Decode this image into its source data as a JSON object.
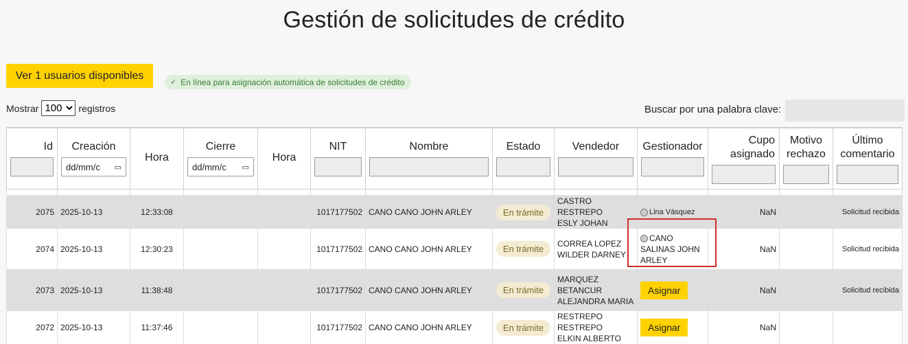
{
  "page": {
    "title": "Gestión de solicitudes de crédito"
  },
  "toolbar": {
    "users_button": "Ver 1 usuarios disponibles",
    "status_text": "En línea para asignación automática de solicitudes de crédito",
    "show_prefix": "Mostrar",
    "show_value": "100",
    "show_suffix": "registros",
    "search_label": "Buscar por una palabra clave:",
    "search_value": ""
  },
  "table": {
    "headers": {
      "id": "Id",
      "creacion": "Creación",
      "hora1": "Hora",
      "cierre": "Cierre",
      "hora2": "Hora",
      "nit": "NIT",
      "nombre": "Nombre",
      "estado": "Estado",
      "vendedor": "Vendedor",
      "gestionador": "Gestionador",
      "cupo_line1": "Cupo",
      "cupo_line2": "asignado",
      "motivo_line1": "Motivo",
      "motivo_line2": "rechazo",
      "ultimo_line1": "Último",
      "ultimo_line2": "comentario"
    },
    "date_placeholder": "dd/mm/c",
    "assign_label": "Asignar",
    "rows": [
      {
        "id": "2075",
        "creacion": "2025-10-13",
        "hora": "12:33:08",
        "cierre": "",
        "hora2": "",
        "nit": "1017177502",
        "nombre": "CANO CANO JOHN ARLEY",
        "estado": "En trámite",
        "vendedor_l1": "CASTRO RESTREPO",
        "vendedor_l2": "ESLY JOHAN",
        "vendedor_l3": "",
        "gestionador": "Lina Vásquez",
        "cupo": "NaN",
        "motivo": "",
        "comentario": "Solicitud recibida"
      },
      {
        "id": "2074",
        "creacion": "2025-10-13",
        "hora": "12:30:23",
        "cierre": "",
        "hora2": "",
        "nit": "1017177502",
        "nombre": "CANO CANO JOHN ARLEY",
        "estado": "En trámite",
        "vendedor_l1": "CORREA LOPEZ",
        "vendedor_l2": "WILDER DARNEY",
        "vendedor_l3": "",
        "gestionador_l1": "CANO",
        "gestionador_l2": "SALINAS JOHN",
        "gestionador_l3": "ARLEY",
        "cupo": "NaN",
        "motivo": "",
        "comentario": "Solicitud recibida"
      },
      {
        "id": "2073",
        "creacion": "2025-10-13",
        "hora": "11:38:48",
        "cierre": "",
        "hora2": "",
        "nit": "1017177502",
        "nombre": "CANO CANO JOHN ARLEY",
        "estado": "En trámite",
        "vendedor_l1": "MARQUEZ",
        "vendedor_l2": "BETANCUR",
        "vendedor_l3": "ALEJANDRA MARIA",
        "cupo": "NaN",
        "motivo": "",
        "comentario": "Solicitud recibida"
      },
      {
        "id": "2072",
        "creacion": "2025-10-13",
        "hora": "11:37:46",
        "cierre": "",
        "hora2": "",
        "nit": "1017177502",
        "nombre": "CANO CANO JOHN ARLEY",
        "estado": "En trámite",
        "vendedor_l1": "RESTREPO RESTREPO",
        "vendedor_l2": "ELKIN ALBERTO",
        "vendedor_l3": "",
        "cupo": "NaN",
        "motivo": "",
        "comentario": ""
      }
    ]
  },
  "colors": {
    "accent_yellow": "#ffd200",
    "link_blue": "#1a6fd0",
    "highlight_red": "#d42a2a",
    "status_green": "#3b7a35"
  }
}
